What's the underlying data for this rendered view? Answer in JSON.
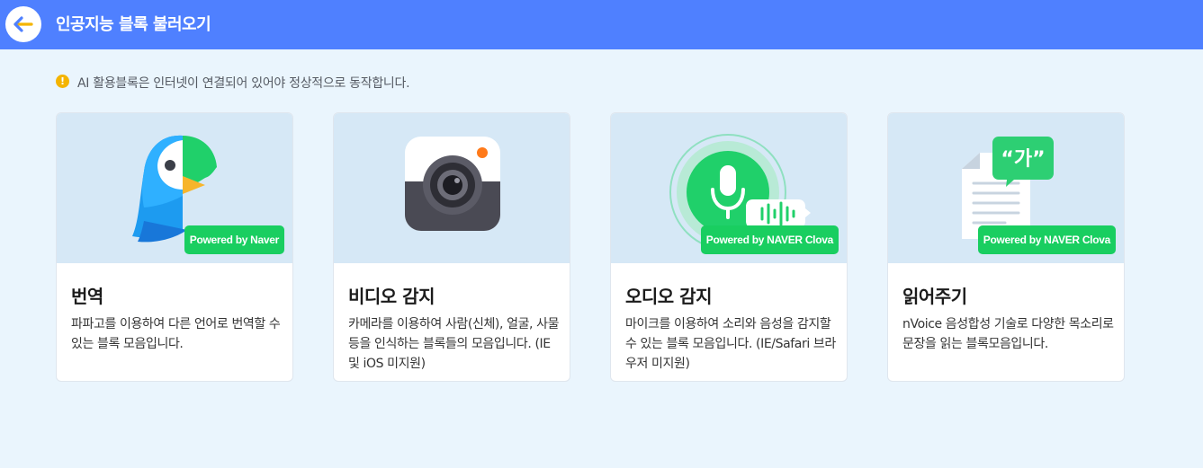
{
  "header": {
    "title": "인공지능 블록 불러오기",
    "back_icon": "arrow-left-icon",
    "color": "#4f80ff"
  },
  "notice": {
    "icon": "exclamation-icon",
    "text": "AI 활용블록은 인터넷이 연결되어 있어야 정상적으로 동작합니다."
  },
  "cards": [
    {
      "title": "번역",
      "description": "파파고를 이용하여 다른 언어로 번역할 수 있는 블록 모음입니다.",
      "badge": "Powered by Naver",
      "icon": "papago-parrot-icon"
    },
    {
      "title": "비디오 감지",
      "description": "카메라를 이용하여 사람(신체), 얼굴, 사물 등을 인식하는 블록들의 모음입니다. (IE 및 iOS 미지원)",
      "badge": "",
      "icon": "camera-icon"
    },
    {
      "title": "오디오 감지",
      "description": "마이크를 이용하여 소리와 음성을 감지할 수 있는 블록 모음입니다. (IE/Safari 브라우저 미지원)",
      "badge": "Powered by NAVER Clova",
      "icon": "microphone-icon"
    },
    {
      "title": "읽어주기",
      "description": "nVoice 음성합성 기술로 다양한 목소리로 문장을 읽는 블록모음입니다.",
      "badge": "Powered by NAVER Clova",
      "icon": "speech-document-icon",
      "bubble_text": "“가”"
    }
  ],
  "colors": {
    "background": "#eaf5fd",
    "badge": "#19ce60",
    "card_image_bg": "#d6e8f6"
  }
}
